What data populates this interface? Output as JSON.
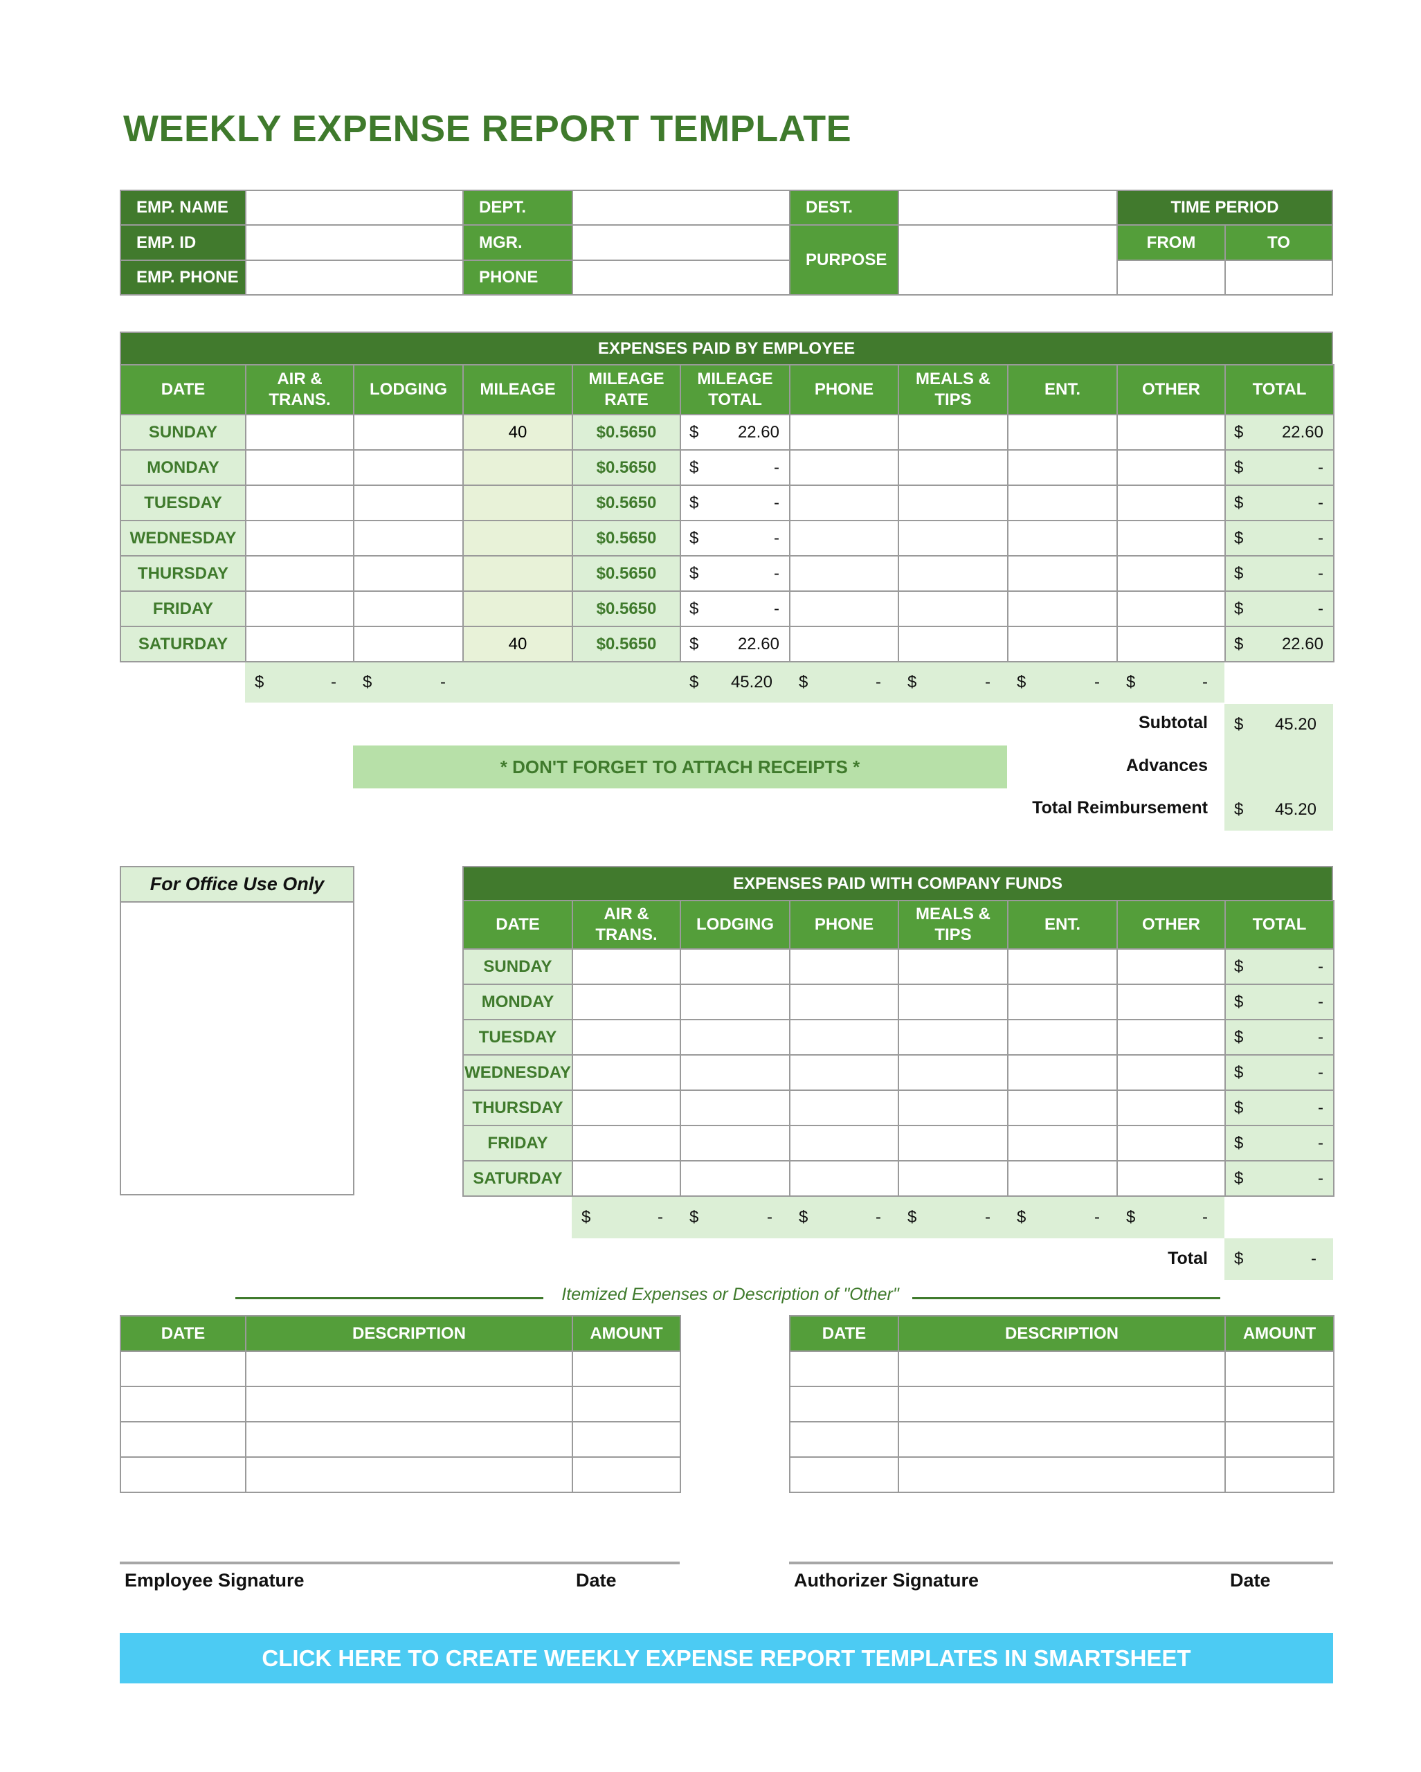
{
  "title": "WEEKLY EXPENSE REPORT TEMPLATE",
  "info": {
    "emp_name_label": "EMP. NAME",
    "emp_id_label": "EMP. ID",
    "emp_phone_label": "EMP. PHONE",
    "dept_label": "DEPT.",
    "mgr_label": "MGR.",
    "phone_label": "PHONE",
    "dest_label": "DEST.",
    "purpose_label": "PURPOSE",
    "time_period_label": "TIME PERIOD",
    "from_label": "FROM",
    "to_label": "TO",
    "emp_name": "",
    "emp_id": "",
    "emp_phone": "",
    "dept": "",
    "mgr": "",
    "phone": "",
    "dest": "",
    "purpose": "",
    "from": "",
    "to": ""
  },
  "employee_expenses": {
    "title": "EXPENSES PAID BY EMPLOYEE",
    "columns": [
      "DATE",
      "AIR &\nTRANS.",
      "LODGING",
      "MILEAGE",
      "MILEAGE\nRATE",
      "MILEAGE\nTOTAL",
      "PHONE",
      "MEALS &\nTIPS",
      "ENT.",
      "OTHER",
      "TOTAL"
    ],
    "rows": [
      {
        "day": "SUNDAY",
        "air": "",
        "lodging": "",
        "mileage": "40",
        "rate": "$0.5650",
        "mileage_total": "22.60",
        "phone": "",
        "meals": "",
        "ent": "",
        "other": "",
        "total": "22.60"
      },
      {
        "day": "MONDAY",
        "air": "",
        "lodging": "",
        "mileage": "",
        "rate": "$0.5650",
        "mileage_total": "-",
        "phone": "",
        "meals": "",
        "ent": "",
        "other": "",
        "total": "-"
      },
      {
        "day": "TUESDAY",
        "air": "",
        "lodging": "",
        "mileage": "",
        "rate": "$0.5650",
        "mileage_total": "-",
        "phone": "",
        "meals": "",
        "ent": "",
        "other": "",
        "total": "-"
      },
      {
        "day": "WEDNESDAY",
        "air": "",
        "lodging": "",
        "mileage": "",
        "rate": "$0.5650",
        "mileage_total": "-",
        "phone": "",
        "meals": "",
        "ent": "",
        "other": "",
        "total": "-"
      },
      {
        "day": "THURSDAY",
        "air": "",
        "lodging": "",
        "mileage": "",
        "rate": "$0.5650",
        "mileage_total": "-",
        "phone": "",
        "meals": "",
        "ent": "",
        "other": "",
        "total": "-"
      },
      {
        "day": "FRIDAY",
        "air": "",
        "lodging": "",
        "mileage": "",
        "rate": "$0.5650",
        "mileage_total": "-",
        "phone": "",
        "meals": "",
        "ent": "",
        "other": "",
        "total": "-"
      },
      {
        "day": "SATURDAY",
        "air": "",
        "lodging": "",
        "mileage": "40",
        "rate": "$0.5650",
        "mileage_total": "22.60",
        "phone": "",
        "meals": "",
        "ent": "",
        "other": "",
        "total": "22.60"
      }
    ],
    "column_totals": {
      "air": "-",
      "lodging": "-",
      "mileage_total": "45.20",
      "phone": "-",
      "meals": "-",
      "ent": "-",
      "other": "-"
    },
    "currency_symbol": "$",
    "subtotal_label": "Subtotal",
    "subtotal": "45.20",
    "advances_label": "Advances",
    "advances": "",
    "reimbursement_label": "Total Reimbursement",
    "reimbursement": "45.20",
    "receipts_note": "* DON'T FORGET TO ATTACH RECEIPTS *"
  },
  "office_use": {
    "label": "For Office Use Only",
    "value": ""
  },
  "company_expenses": {
    "title": "EXPENSES PAID WITH COMPANY FUNDS",
    "columns": [
      "DATE",
      "AIR &\nTRANS.",
      "LODGING",
      "PHONE",
      "MEALS &\nTIPS",
      "ENT.",
      "OTHER",
      "TOTAL"
    ],
    "rows": [
      {
        "day": "SUNDAY",
        "total": "-"
      },
      {
        "day": "MONDAY",
        "total": "-"
      },
      {
        "day": "TUESDAY",
        "total": "-"
      },
      {
        "day": "WEDNESDAY",
        "total": "-"
      },
      {
        "day": "THURSDAY",
        "total": "-"
      },
      {
        "day": "FRIDAY",
        "total": "-"
      },
      {
        "day": "SATURDAY",
        "total": "-"
      }
    ],
    "column_totals": [
      "-",
      "-",
      "-",
      "-",
      "-",
      "-"
    ],
    "total_label": "Total",
    "total": "-"
  },
  "itemized": {
    "caption": "Itemized Expenses or Description of \"Other\"",
    "columns": [
      "DATE",
      "DESCRIPTION",
      "AMOUNT"
    ],
    "left_rows": 4,
    "right_rows": 4
  },
  "signatures": {
    "employee_label": "Employee Signature",
    "employee_date_label": "Date",
    "authorizer_label": "Authorizer Signature",
    "authorizer_date_label": "Date"
  },
  "cta": {
    "label": "CLICK HERE TO CREATE WEEKLY EXPENSE REPORT TEMPLATES IN SMARTSHEET"
  },
  "colors": {
    "dark_green": "#417a2d",
    "green": "#549e3a",
    "light_green": "#dcefd6",
    "banner_green": "#b7e0a8",
    "cta_blue": "#4ccbf3"
  }
}
